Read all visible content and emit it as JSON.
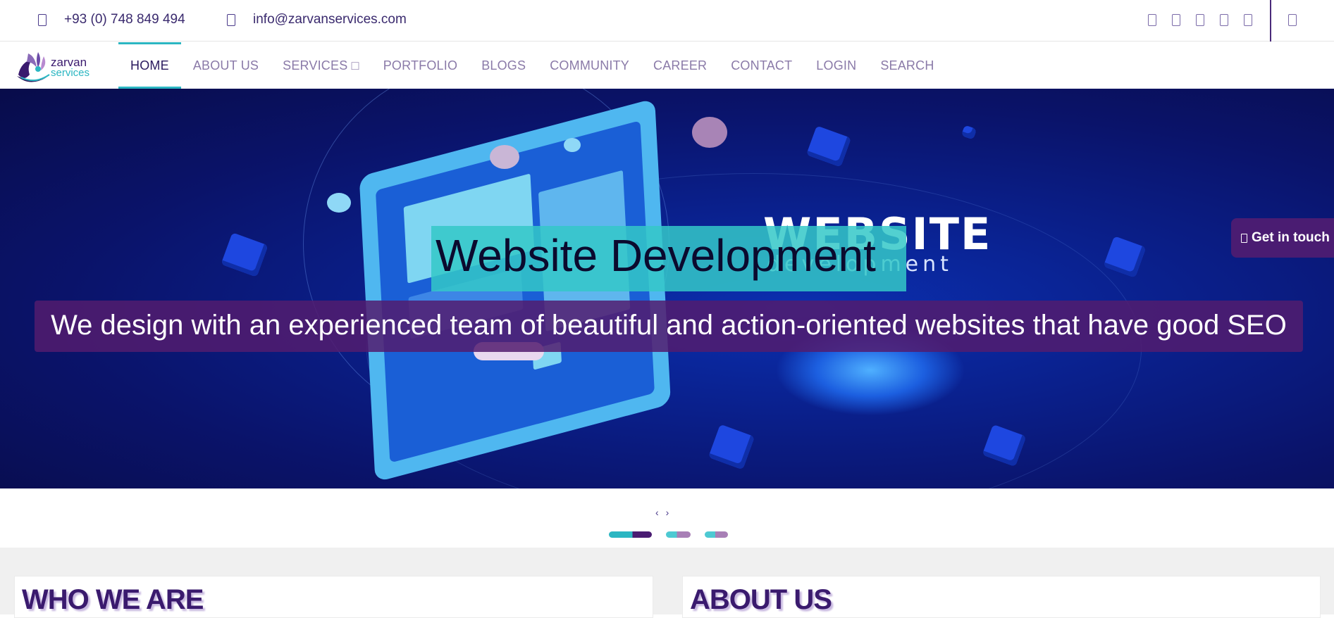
{
  "topbar": {
    "phone": "+93 (0) 748 849 494",
    "email": "info@zarvanservices.com",
    "phone_icon": "phone-icon",
    "email_icon": "envelope-icon",
    "social_icons": [
      "facebook-icon",
      "twitter-icon",
      "instagram-icon",
      "linkedin-icon",
      "youtube-icon"
    ],
    "extra_icon": "menu-icon"
  },
  "nav": {
    "logo_line1": "zarvan",
    "logo_line2": "services",
    "items": [
      {
        "label": "HOME",
        "active": true
      },
      {
        "label": "ABOUT US"
      },
      {
        "label": "SERVICES □"
      },
      {
        "label": "PORTFOLIO"
      },
      {
        "label": "BLOGS"
      },
      {
        "label": "COMMUNITY"
      },
      {
        "label": "CAREER"
      },
      {
        "label": "CONTACT"
      },
      {
        "label": "LOGIN"
      },
      {
        "label": "SEARCH"
      }
    ]
  },
  "hero": {
    "brand_word": "WEBSITE",
    "brand_sub": "development",
    "headline": "Website Development",
    "subtext": "We design with an experienced team of beautiful and action-oriented websites that have good SEO",
    "prev": "‹",
    "next": "›",
    "active_slide": 1,
    "slide_count": 3
  },
  "cta": {
    "label": "Get in touch",
    "icon": "chat-icon"
  },
  "sections": {
    "left_title": "WHO WE ARE",
    "right_title": "ABOUT US"
  },
  "colors": {
    "accent_teal": "#2bb6c2",
    "brand_purple": "#4a1c72",
    "heading_purple": "#3a1a6e"
  }
}
